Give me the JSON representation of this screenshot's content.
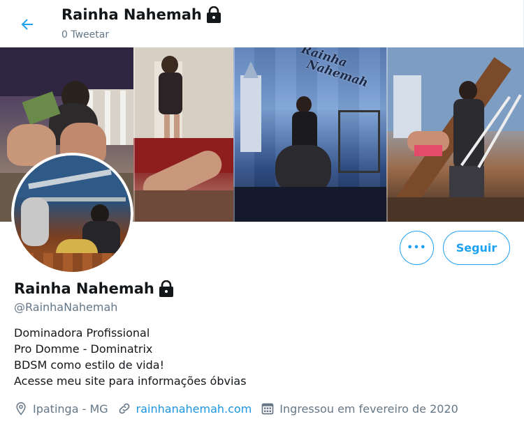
{
  "header": {
    "title": "Rainha Nahemah",
    "subtitle": "0 Tweetar"
  },
  "banner": {
    "watermark_line1": "Rainha",
    "watermark_line2": "Nahemah"
  },
  "actions": {
    "more_label": "•••",
    "follow_label": "Seguir"
  },
  "profile": {
    "name": "Rainha Nahemah",
    "handle": "@RainhaNahemah",
    "bio": [
      "Dominadora Profissional",
      "Pro Domme - Dominatrix",
      "BDSM como estilo de vida!",
      "Acesse meu site para informações óbvias"
    ],
    "location": "Ipatinga - MG",
    "website": "rainhanahemah.com",
    "joined": "Ingressou em fevereiro de 2020"
  },
  "colors": {
    "accent": "#1da1f2",
    "link": "#1b95e0",
    "muted": "#657786",
    "text": "#14171a"
  },
  "icons": {
    "back": "arrow-left-icon",
    "lock": "lock-icon",
    "location": "location-pin-icon",
    "link": "link-icon",
    "calendar": "calendar-icon"
  }
}
